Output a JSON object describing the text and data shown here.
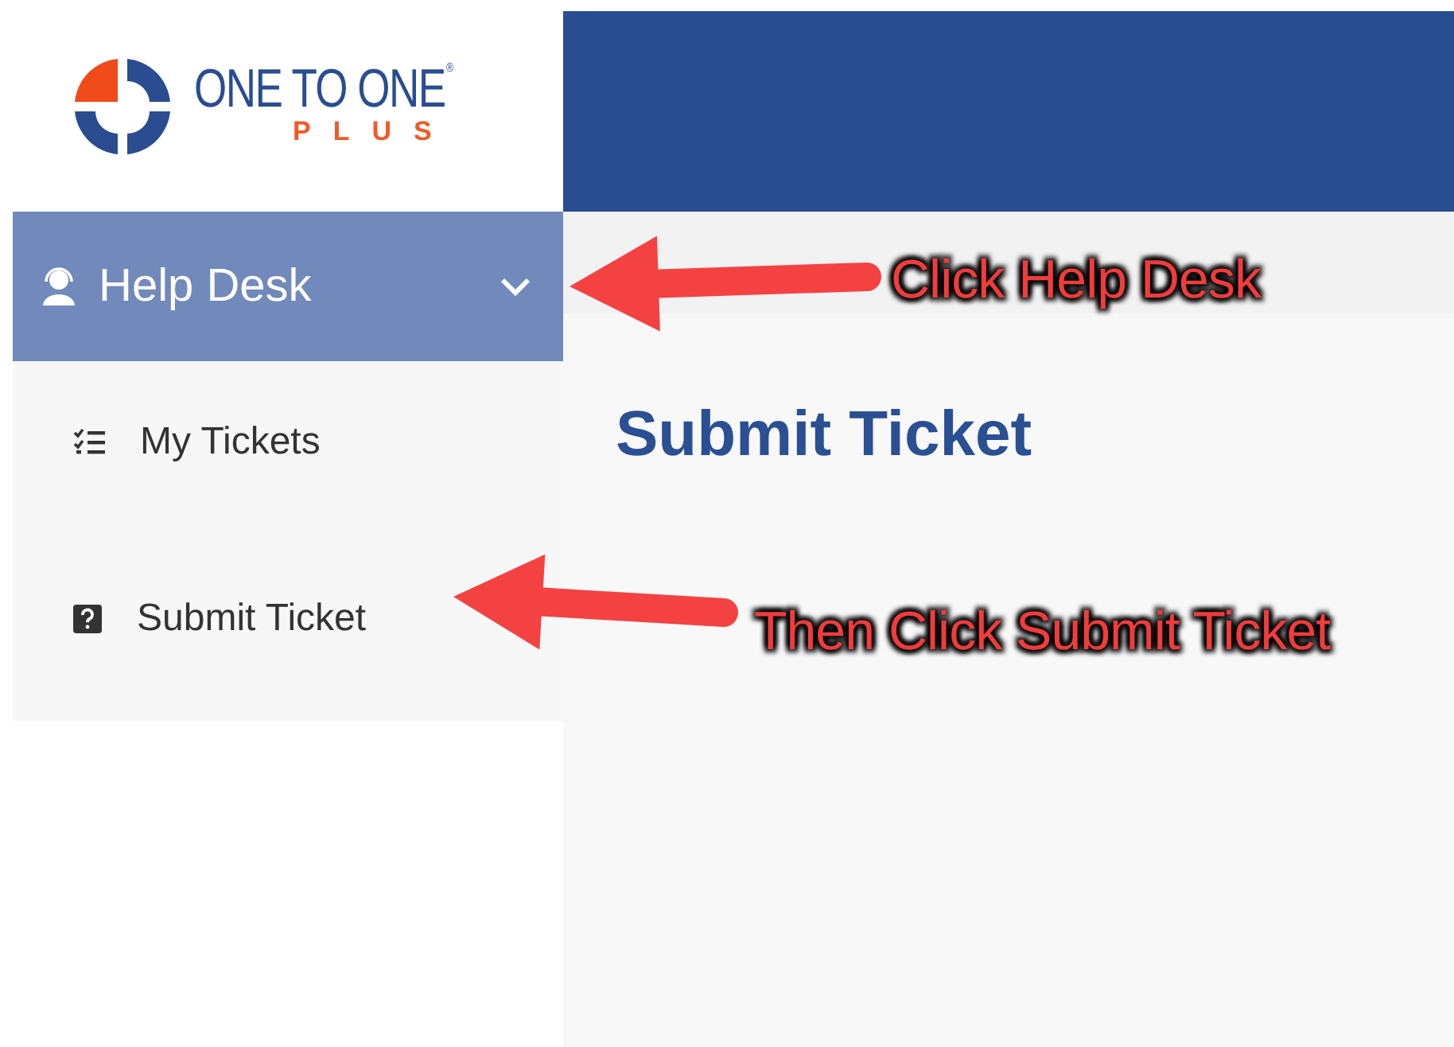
{
  "logo": {
    "name": "ONE TO ONE",
    "mark": "®",
    "tagline": "PLUS"
  },
  "sidebar": {
    "menu": {
      "label": "Help Desk",
      "expanded": true,
      "items": [
        {
          "label": "My Tickets",
          "kind": "list"
        },
        {
          "label": "Submit Ticket",
          "kind": "question"
        }
      ]
    }
  },
  "main": {
    "title": "Submit Ticket"
  },
  "annotations": [
    {
      "text": "Click Help Desk",
      "kind": "upper"
    },
    {
      "text": "Then Click Submit Ticket",
      "kind": "lower"
    }
  ]
}
